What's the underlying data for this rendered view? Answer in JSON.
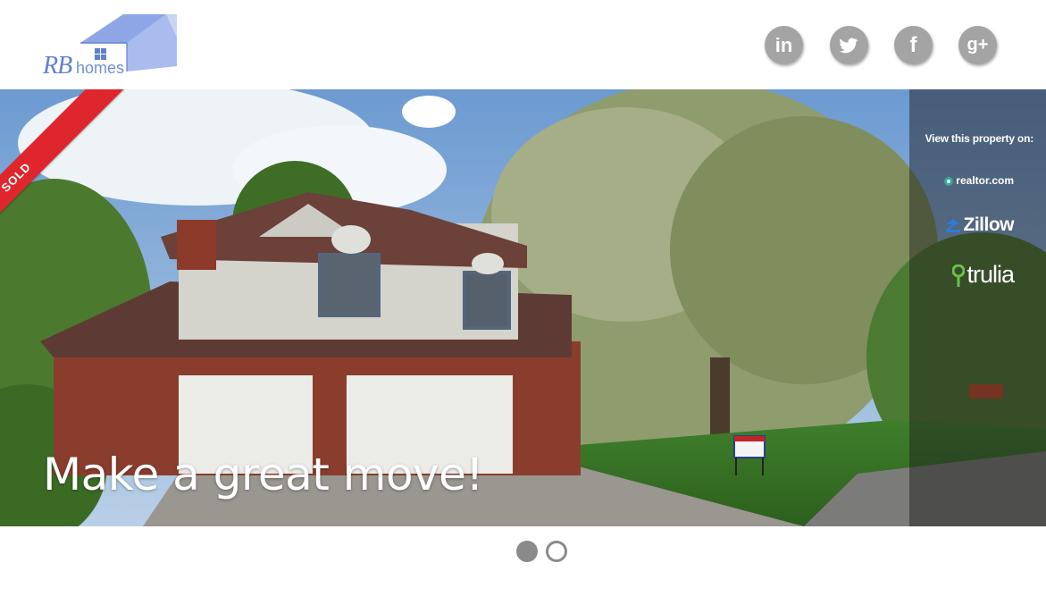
{
  "logo": {
    "mark": "RB",
    "word": "homes"
  },
  "social": {
    "linkedin": {
      "label": "in",
      "icon": "linkedin-icon"
    },
    "twitter": {
      "icon": "twitter-icon"
    },
    "facebook": {
      "label": "f",
      "icon": "facebook-icon"
    },
    "gplus": {
      "label": "g+",
      "icon": "google-plus-icon"
    }
  },
  "hero": {
    "badge": "SOLD",
    "tagline": "Make a great move!",
    "panel_title": "View this property on:",
    "portals": [
      {
        "label": "realtor.com",
        "icon": "realtor-icon"
      },
      {
        "label": "Zillow",
        "icon": "zillow-icon"
      },
      {
        "label": "trulia",
        "icon": "trulia-icon"
      }
    ]
  },
  "carousel": {
    "slides": 2,
    "active": 1
  },
  "colors": {
    "ribbon": "#e0262d",
    "social": "#a4a4a4",
    "logo": "#6f8fda"
  }
}
